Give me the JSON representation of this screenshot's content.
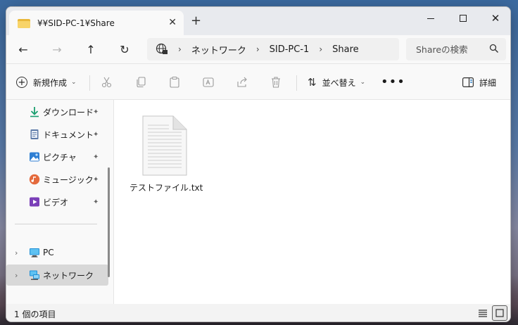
{
  "window": {
    "tab_title": "¥¥SID-PC-1¥Share",
    "tab_close": "✕",
    "new_tab": "+",
    "minimize": "",
    "maximize": "",
    "close": "✕"
  },
  "nav": {
    "back": "←",
    "forward": "→",
    "up": "↑",
    "refresh": "↻"
  },
  "address": {
    "separator": "›",
    "crumbs": [
      "ネットワーク",
      "SID-PC-1",
      "Share"
    ]
  },
  "search": {
    "placeholder": "Shareの検索"
  },
  "commands": {
    "new": "新規作成",
    "sort": "並べ替え",
    "more": "•••",
    "details": "詳細",
    "caret": "⌄"
  },
  "sidebar": {
    "pinned": [
      {
        "label": "ダウンロード",
        "icon": "download-icon"
      },
      {
        "label": "ドキュメント",
        "icon": "documents-icon"
      },
      {
        "label": "ピクチャ",
        "icon": "pictures-icon"
      },
      {
        "label": "ミュージック",
        "icon": "music-icon"
      },
      {
        "label": "ビデオ",
        "icon": "videos-icon"
      }
    ],
    "pin_glyph": "📌",
    "expander": "›",
    "tree": [
      {
        "label": "PC",
        "icon": "pc-icon"
      },
      {
        "label": "ネットワーク",
        "icon": "network-icon",
        "selected": true
      }
    ]
  },
  "content": {
    "files": [
      {
        "name": "テストファイル.txt",
        "icon": "text-file-icon"
      }
    ]
  },
  "status": {
    "count": "1 個の項目"
  },
  "colors": {
    "accent": "#0067c0",
    "window_bg": "#f3f3f3",
    "content_bg": "#ffffff",
    "selected_bg": "#d8d8d8"
  }
}
